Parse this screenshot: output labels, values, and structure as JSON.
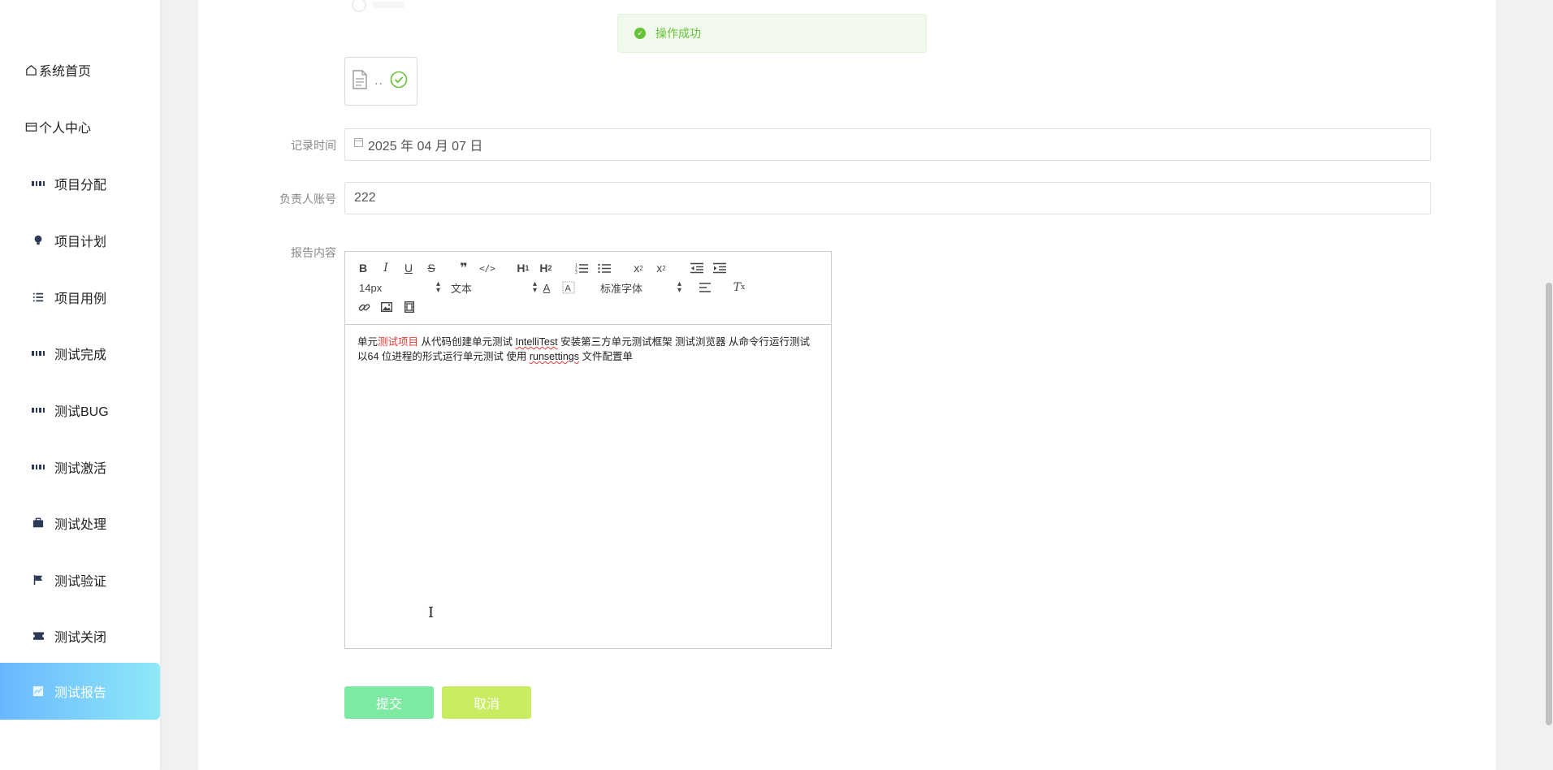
{
  "sidebar": {
    "items": [
      {
        "label": "系统首页",
        "icon": "home-icon"
      },
      {
        "label": "个人中心",
        "icon": "wallet-icon"
      },
      {
        "label": "项目分配",
        "icon": "grid-icon"
      },
      {
        "label": "项目计划",
        "icon": "bulb-icon"
      },
      {
        "label": "项目用例",
        "icon": "list-icon"
      },
      {
        "label": "测试完成",
        "icon": "grid-icon"
      },
      {
        "label": "测试BUG",
        "icon": "grid-icon"
      },
      {
        "label": "测试激活",
        "icon": "grid-icon"
      },
      {
        "label": "测试处理",
        "icon": "briefcase-icon"
      },
      {
        "label": "测试验证",
        "icon": "flag-icon"
      },
      {
        "label": "测试关闭",
        "icon": "ticket-icon"
      },
      {
        "label": "测试报告",
        "icon": "chart-icon",
        "active": true
      }
    ]
  },
  "toast": {
    "message": "操作成功"
  },
  "file_card": {
    "dots": ".."
  },
  "form": {
    "record_time": {
      "label": "记录时间",
      "value": "2025 年 04 月 07 日"
    },
    "owner_account": {
      "label": "负责人账号",
      "value": "222"
    },
    "report_content": {
      "label": "报告内容"
    }
  },
  "editor": {
    "font_size": "14px",
    "header_select": "文本",
    "font_family": "标准字体",
    "content": {
      "p1": "单元",
      "p2_red": "测试项目",
      "p3": " 从代码创建单元测试 ",
      "p4_wavy": "IntelliTest",
      "p5": " 安装第三方单元测试框架 测试浏览器 从命令行运行测试 以64 位进程的形式运行单元测试 使用 ",
      "p6_wavy": "runsettings",
      "p7": " 文件配置单"
    }
  },
  "buttons": {
    "submit": "提交",
    "cancel": "取消"
  },
  "colors": {
    "accent_gradient_start": "#69b8ff",
    "accent_gradient_end": "#8fe8f7",
    "success": "#67c23a",
    "submit": "#7deaa2",
    "cancel": "#c9ec63"
  }
}
